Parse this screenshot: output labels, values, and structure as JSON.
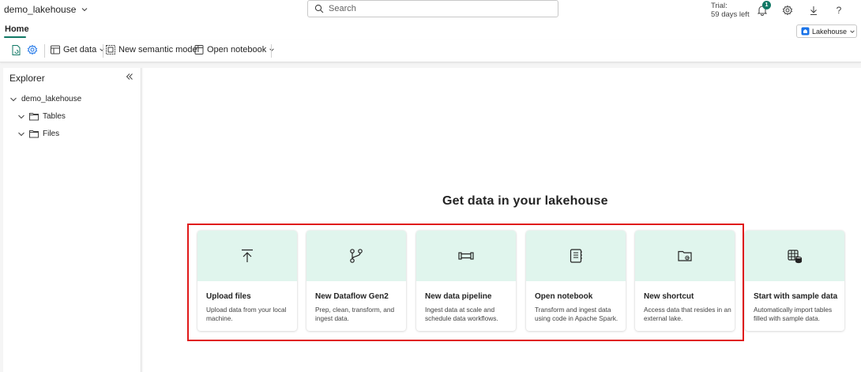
{
  "header": {
    "workspace_name": "demo_lakehouse",
    "search_placeholder": "Search",
    "trial_line1": "Trial:",
    "trial_line2": "59 days left",
    "notification_count": "1"
  },
  "tabs": {
    "home": "Home"
  },
  "lakehouse_switch": {
    "label": "Lakehouse"
  },
  "toolbar": {
    "get_data": "Get data",
    "new_semantic_model": "New semantic model",
    "open_notebook": "Open notebook"
  },
  "explorer": {
    "title": "Explorer",
    "root": "demo_lakehouse",
    "children": [
      "Tables",
      "Files"
    ]
  },
  "main": {
    "headline": "Get data in your lakehouse",
    "cards": [
      {
        "title": "Upload files",
        "desc": "Upload data from your local machine.",
        "icon": "upload-icon"
      },
      {
        "title": "New Dataflow Gen2",
        "desc": "Prep, clean, transform, and ingest data.",
        "icon": "dataflow-icon"
      },
      {
        "title": "New data pipeline",
        "desc": "Ingest data at scale and schedule data workflows.",
        "icon": "pipeline-icon"
      },
      {
        "title": "Open notebook",
        "desc": "Transform and ingest data using code in Apache Spark.",
        "icon": "notebook-icon"
      },
      {
        "title": "New shortcut",
        "desc": "Access data that resides in an external lake.",
        "icon": "shortcut-folder-icon"
      },
      {
        "title": "Start with sample data",
        "desc": "Automatically import tables filled with sample data.",
        "icon": "sample-data-icon"
      }
    ]
  },
  "colors": {
    "accent": "#117865",
    "card_top": "#e0f5ed",
    "highlight_border": "#e01919"
  }
}
